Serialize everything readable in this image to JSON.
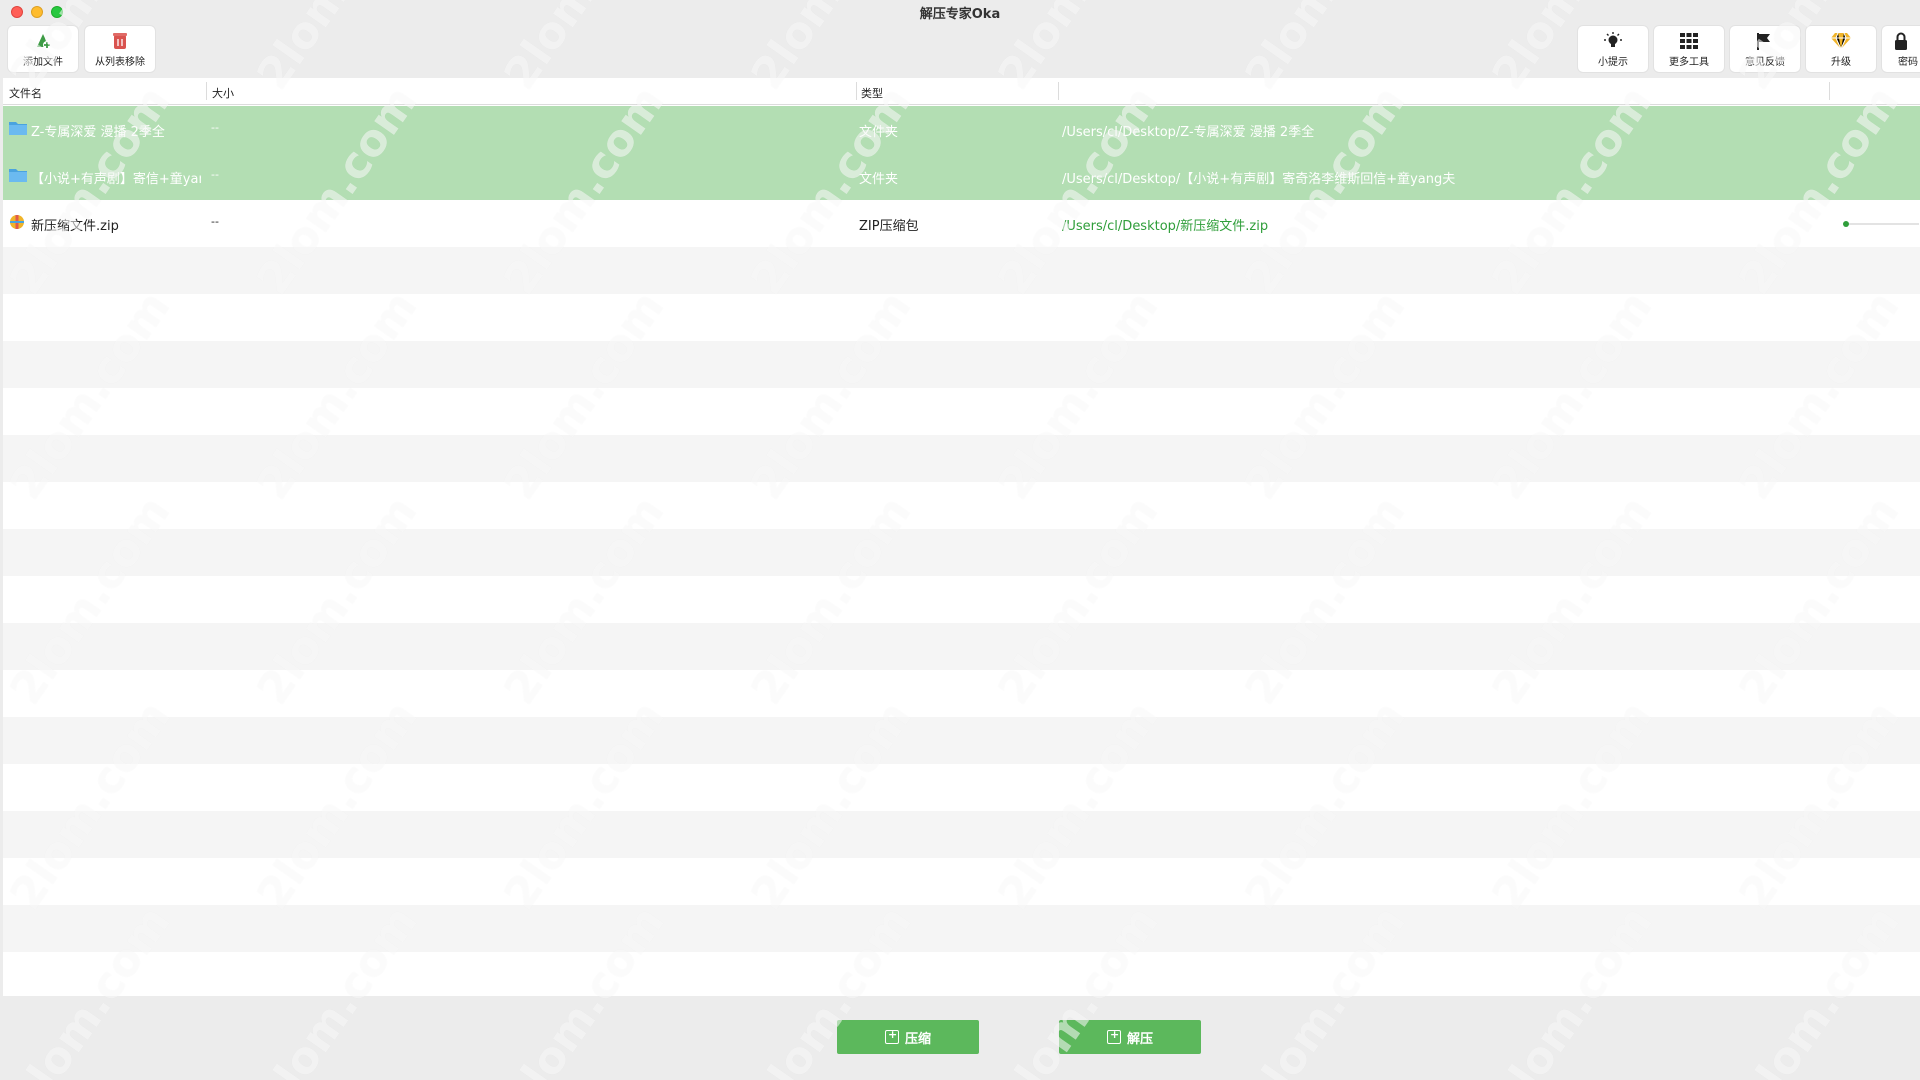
{
  "window": {
    "title": "解压专家Oka"
  },
  "toolbar": {
    "left": [
      {
        "name": "add-file-button",
        "label": "添加文件",
        "icon": "add-file-icon"
      },
      {
        "name": "remove-from-list-button",
        "label": "从列表移除",
        "icon": "trash-icon"
      }
    ],
    "right": [
      {
        "name": "tips-button",
        "label": "小提示",
        "icon": "lightbulb-icon"
      },
      {
        "name": "more-tools-button",
        "label": "更多工具",
        "icon": "grid-icon"
      },
      {
        "name": "feedback-button",
        "label": "意见反馈",
        "icon": "flag-icon"
      },
      {
        "name": "upgrade-button",
        "label": "升级",
        "icon": "gem-icon"
      },
      {
        "name": "password-button",
        "label": "密码",
        "icon": "lock-icon"
      }
    ]
  },
  "table": {
    "headers": {
      "name": "文件名",
      "size": "大小",
      "type": "类型"
    },
    "rows": [
      {
        "name": "Z-专属深爱 漫播 2季全",
        "size": "--",
        "type": "文件夹",
        "path": "/Users/cl/Desktop/Z-专属深爱 漫播 2季全",
        "icon": "folder-icon",
        "selected": true
      },
      {
        "name": "【小说+有声剧】寄信+童yang夫",
        "size": "--",
        "type": "文件夹",
        "path": "/Users/cl/Desktop/【小说+有声剧】寄奇洛李维斯回信+童yang夫",
        "icon": "folder-icon",
        "selected": true
      },
      {
        "name": "新压缩文件.zip",
        "size": "--",
        "type": "ZIP压缩包",
        "path": "/Users/cl/Desktop/新压缩文件.zip",
        "icon": "zip-icon",
        "selected": false,
        "progress": 0.02
      }
    ]
  },
  "bottom": {
    "compress_label": "压缩",
    "extract_label": "解压"
  },
  "watermark": {
    "text": "2lom.com"
  },
  "colors": {
    "accent": "#5cb85c",
    "selected_row": "#b3deb3",
    "path_text": "#2f9e3a"
  }
}
